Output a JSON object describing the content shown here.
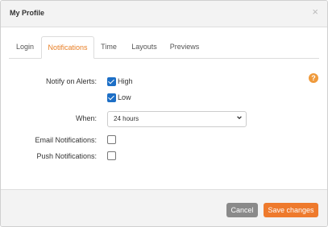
{
  "dialog": {
    "title": "My Profile",
    "close_icon": "×"
  },
  "tabs": [
    {
      "label": "Login",
      "active": false
    },
    {
      "label": "Notifications",
      "active": true
    },
    {
      "label": "Time",
      "active": false
    },
    {
      "label": "Layouts",
      "active": false
    },
    {
      "label": "Previews",
      "active": false
    }
  ],
  "form": {
    "notify_label": "Notify on Alerts:",
    "high_label": "High",
    "high_checked": true,
    "low_label": "Low",
    "low_checked": true,
    "when_label": "When:",
    "when_value": "24 hours",
    "email_label": "Email Notifications:",
    "email_checked": false,
    "push_label": "Push Notifications:",
    "push_checked": false
  },
  "help_icon": "?",
  "footer": {
    "cancel_label": "Cancel",
    "save_label": "Save changes"
  },
  "colors": {
    "accent": "#e87e24",
    "checkbox": "#1d6fc6",
    "save_button": "#ee7a2d",
    "cancel_button": "#8a8a8a"
  }
}
